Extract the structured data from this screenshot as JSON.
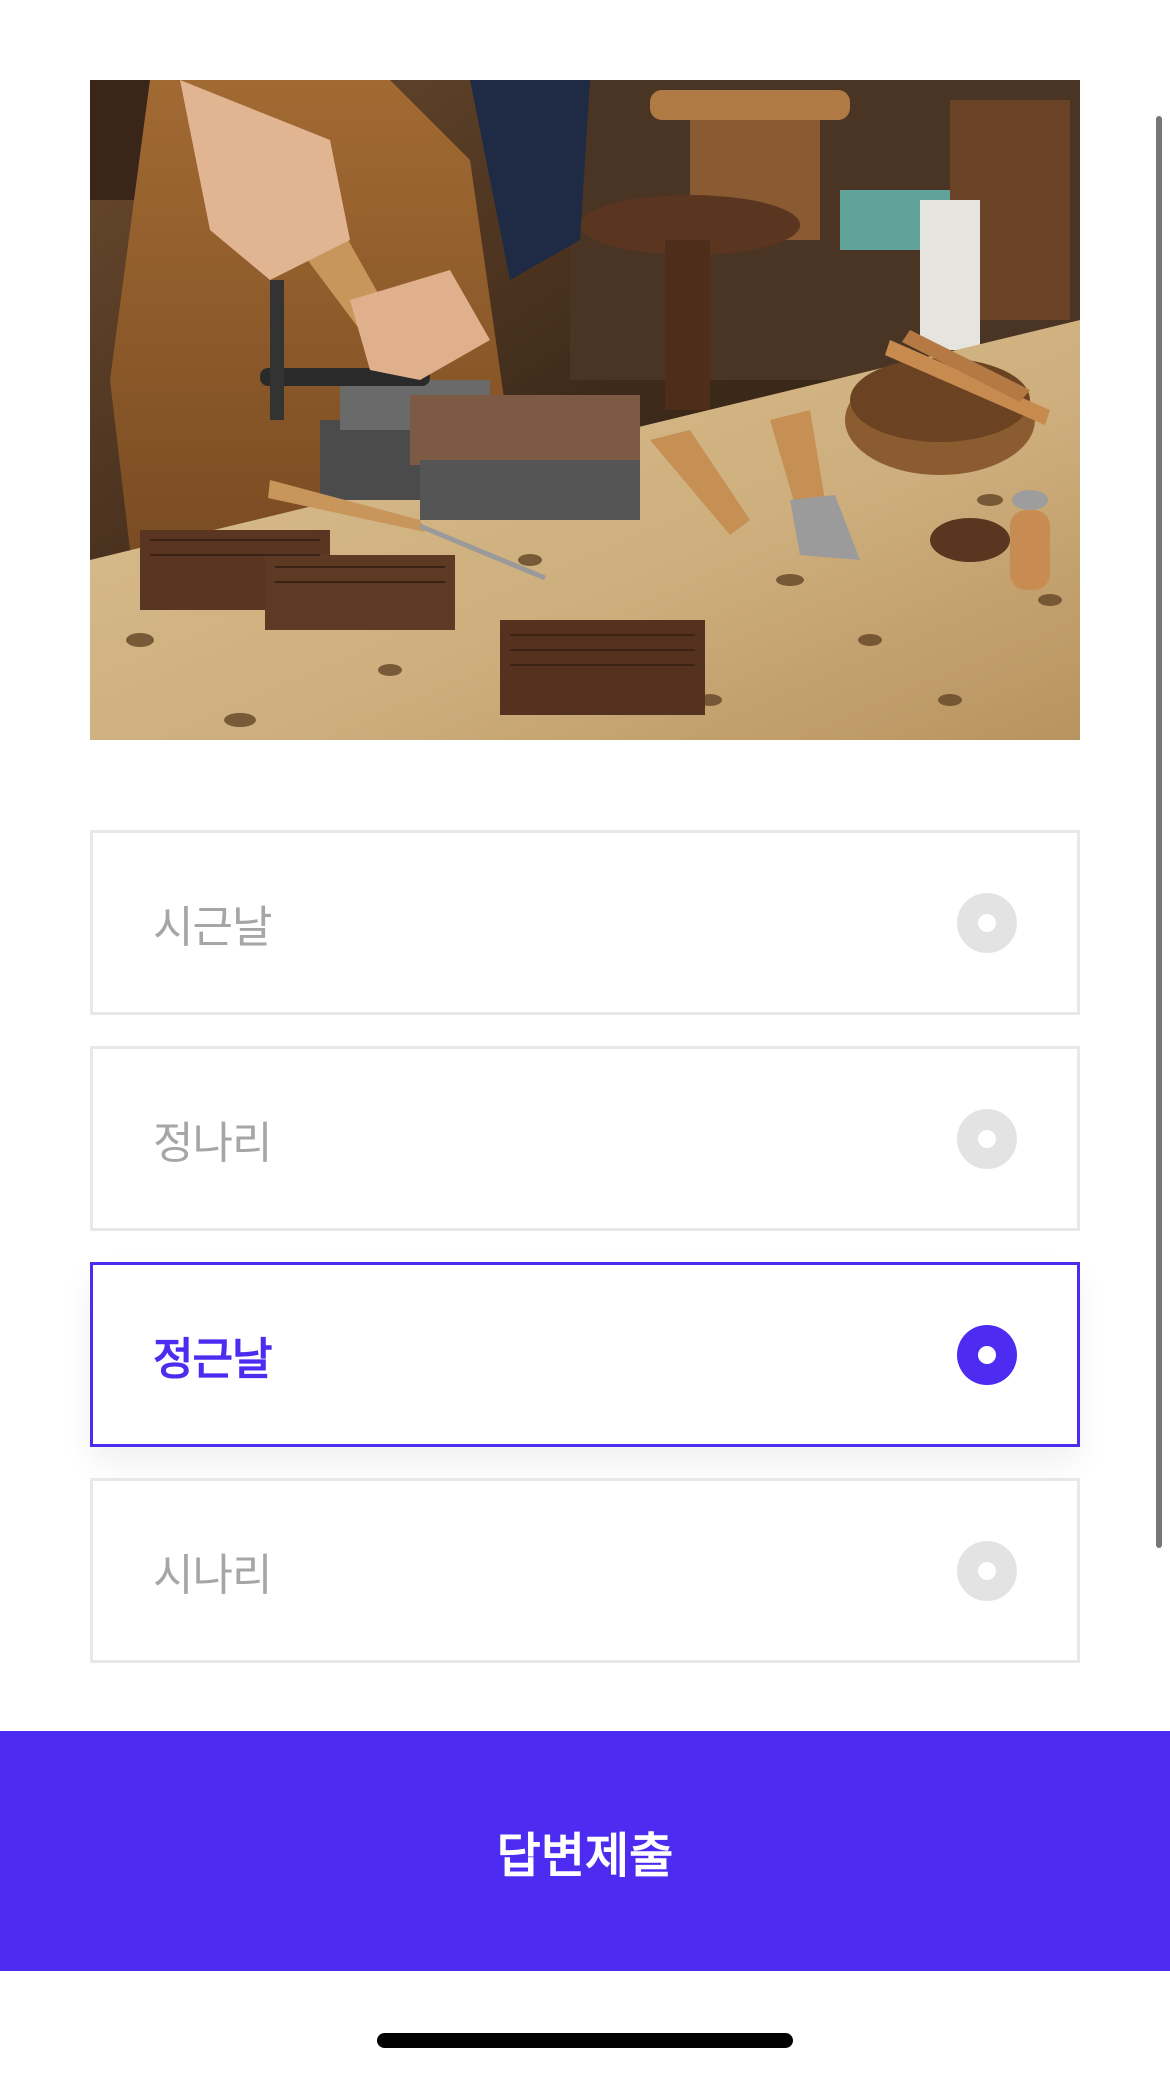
{
  "question": {
    "image": "woodcarving-workshop-photo"
  },
  "options": [
    {
      "label": "시근날",
      "selected": false
    },
    {
      "label": "정나리",
      "selected": false
    },
    {
      "label": "정근날",
      "selected": true
    },
    {
      "label": "시나리",
      "selected": false
    }
  ],
  "submit": {
    "label": "답변제출"
  },
  "colors": {
    "accent": "#4d2bf0",
    "unselected_text": "#a6a6a6",
    "border": "#e8e8e8",
    "radio_unselected": "#e3e3e3"
  }
}
